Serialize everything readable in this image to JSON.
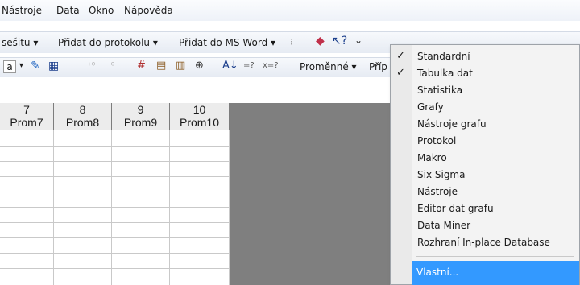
{
  "menubar": {
    "items": [
      "Nástroje",
      "Data",
      "Okno",
      "Nápověda"
    ]
  },
  "toolbar1": {
    "workbook_label": "sešitu ▾",
    "add_protocol_label": "Přidat do protokolu ▾",
    "add_word_label": "Přidat do MS Word ▾"
  },
  "toolbar2": {
    "variables_label": "Proměnné ▾",
    "cases_label": "Příp"
  },
  "grid": {
    "columns": [
      {
        "num": "7",
        "name": "Prom7"
      },
      {
        "num": "8",
        "name": "Prom8"
      },
      {
        "num": "9",
        "name": "Prom9"
      },
      {
        "num": "10",
        "name": "Prom10"
      }
    ]
  },
  "dropdown": {
    "items": [
      {
        "label": "Standardní",
        "checked": true
      },
      {
        "label": "Tabulka dat",
        "checked": true
      },
      {
        "label": "Statistika",
        "checked": false
      },
      {
        "label": "Grafy",
        "checked": false
      },
      {
        "label": "Nástroje grafu",
        "checked": false
      },
      {
        "label": "Protokol",
        "checked": false
      },
      {
        "label": "Makro",
        "checked": false
      },
      {
        "label": "Six Sigma",
        "checked": false
      },
      {
        "label": "Nástroje",
        "checked": false
      },
      {
        "label": "Editor dat grafu",
        "checked": false
      },
      {
        "label": "Data Miner",
        "checked": false
      },
      {
        "label": "Rozhraní In-place Database",
        "checked": false
      }
    ],
    "custom_label": "Vlastní..."
  },
  "colors": {
    "highlight": "#3399ff",
    "grid_grey": "#7f7f7f"
  }
}
